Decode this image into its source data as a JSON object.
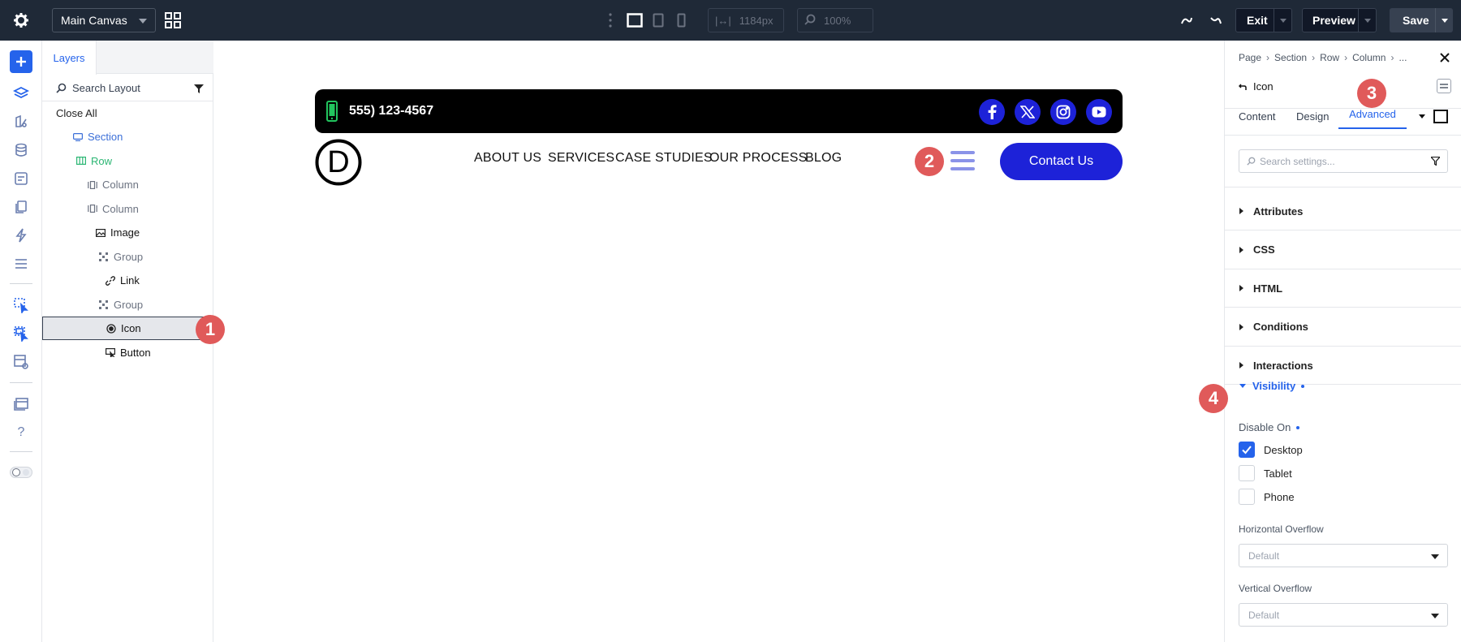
{
  "topbar": {
    "canvas_select": "Main Canvas",
    "width_value": "1184px",
    "zoom_value": "100%",
    "exit_label": "Exit",
    "preview_label": "Preview",
    "save_label": "Save"
  },
  "layers": {
    "tab_label": "Layers",
    "search_placeholder": "Search Layout",
    "close_all": "Close All",
    "items": [
      {
        "label": "Section",
        "icon": "section-icon",
        "color": "#3b6fd8"
      },
      {
        "label": "Row",
        "icon": "row-icon",
        "color": "#2bb673"
      },
      {
        "label": "Column",
        "icon": "column-icon",
        "color": "#6b7280"
      },
      {
        "label": "Column",
        "icon": "column-icon",
        "color": "#6b7280"
      },
      {
        "label": "Image",
        "icon": "image-icon",
        "color": "#222222"
      },
      {
        "label": "Group",
        "icon": "group-icon",
        "color": "#6b7280"
      },
      {
        "label": "Link",
        "icon": "link-icon",
        "color": "#222222"
      },
      {
        "label": "Group",
        "icon": "group-icon",
        "color": "#6b7280"
      },
      {
        "label": "Icon",
        "icon": "icon-module-icon",
        "color": "#222222",
        "selected": true
      },
      {
        "label": "Button",
        "icon": "button-module-icon",
        "color": "#222222"
      }
    ]
  },
  "badges": {
    "b1": "1",
    "b2": "2",
    "b3": "3",
    "b4": "4"
  },
  "canvas": {
    "phone": "555) 123-4567",
    "logo_letter": "D",
    "nav": [
      "ABOUT US",
      "SERVICES",
      "CASE STUDIES",
      "OUR PROCESS",
      "BLOG"
    ],
    "contact_button": "Contact Us",
    "social_icons": [
      "facebook-icon",
      "x-icon",
      "instagram-icon",
      "youtube-icon"
    ],
    "brand_color": "#1d22d8"
  },
  "settings": {
    "breadcrumb": [
      "Page",
      "Section",
      "Row",
      "Column",
      "..."
    ],
    "module_title": "Icon",
    "tabs": [
      "Content",
      "Design",
      "Advanced"
    ],
    "active_tab": "Advanced",
    "search_placeholder": "Search settings...",
    "sections": [
      "Attributes",
      "CSS",
      "HTML",
      "Conditions",
      "Interactions"
    ],
    "visibility": {
      "title": "Visibility",
      "disable_on_label": "Disable On",
      "options": [
        {
          "label": "Desktop",
          "checked": true
        },
        {
          "label": "Tablet",
          "checked": false
        },
        {
          "label": "Phone",
          "checked": false
        }
      ],
      "horizontal_overflow_label": "Horizontal Overflow",
      "horizontal_overflow_value": "Default",
      "vertical_overflow_label": "Vertical Overflow",
      "vertical_overflow_value": "Default"
    }
  }
}
